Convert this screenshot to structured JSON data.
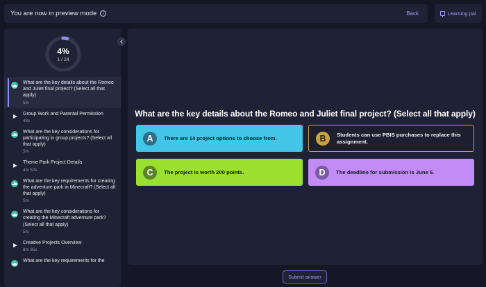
{
  "topbar": {
    "mode_text": "You are now in preview mode",
    "info_icon": "info-icon",
    "back_label": "Back"
  },
  "learning_pal": {
    "label": "Learning pal",
    "icon": "chat-icon"
  },
  "progress": {
    "percent_label": "4%",
    "count_label": "1 / 24",
    "fraction": 0.04,
    "ring_color": "#8f8ef2",
    "track_color": "#33374d"
  },
  "lessons": [
    {
      "icon": "quiz",
      "title": "What are the key details about the Romeo and Juliet final project? (Select all that apply)",
      "duration": "5m",
      "active": true
    },
    {
      "icon": "video",
      "title": "Group Work and Parental Permission",
      "duration": "48s",
      "active": false
    },
    {
      "icon": "quiz",
      "title": "What are the key considerations for participating in group projects? (Select all that apply)",
      "duration": "5m",
      "active": false
    },
    {
      "icon": "video",
      "title": "Theme Park Project Details",
      "duration": "4m 52s",
      "active": false
    },
    {
      "icon": "quiz",
      "title": "What are the key requirements for creating the adventure park in Minecraft? (Select all that apply)",
      "duration": "5m",
      "active": false
    },
    {
      "icon": "quiz",
      "title": "What are the key considerations for creating the Minecraft adventure park? (Select all that apply)",
      "duration": "5m",
      "active": false
    },
    {
      "icon": "video",
      "title": "Creative Projects Overview",
      "duration": "8m 35s",
      "active": false
    },
    {
      "icon": "quiz",
      "title": "What are the key requirements for the",
      "duration": "",
      "active": false
    }
  ],
  "question": {
    "text": "What are the key details about the Romeo and Juliet final project? (Select all that apply)"
  },
  "options": [
    {
      "letter": "A",
      "text": "There are 14 project options to choose from.",
      "color": "#42c5e7"
    },
    {
      "letter": "B",
      "text": "Students can use PBIS purchases to replace this assignment.",
      "color": "#c9a33f"
    },
    {
      "letter": "C",
      "text": "The project is worth 200 points.",
      "color": "#9be02f"
    },
    {
      "letter": "D",
      "text": "The deadline for submission is June 6.",
      "color": "#c28bf5"
    }
  ],
  "submit": {
    "label": "Submit answer"
  }
}
